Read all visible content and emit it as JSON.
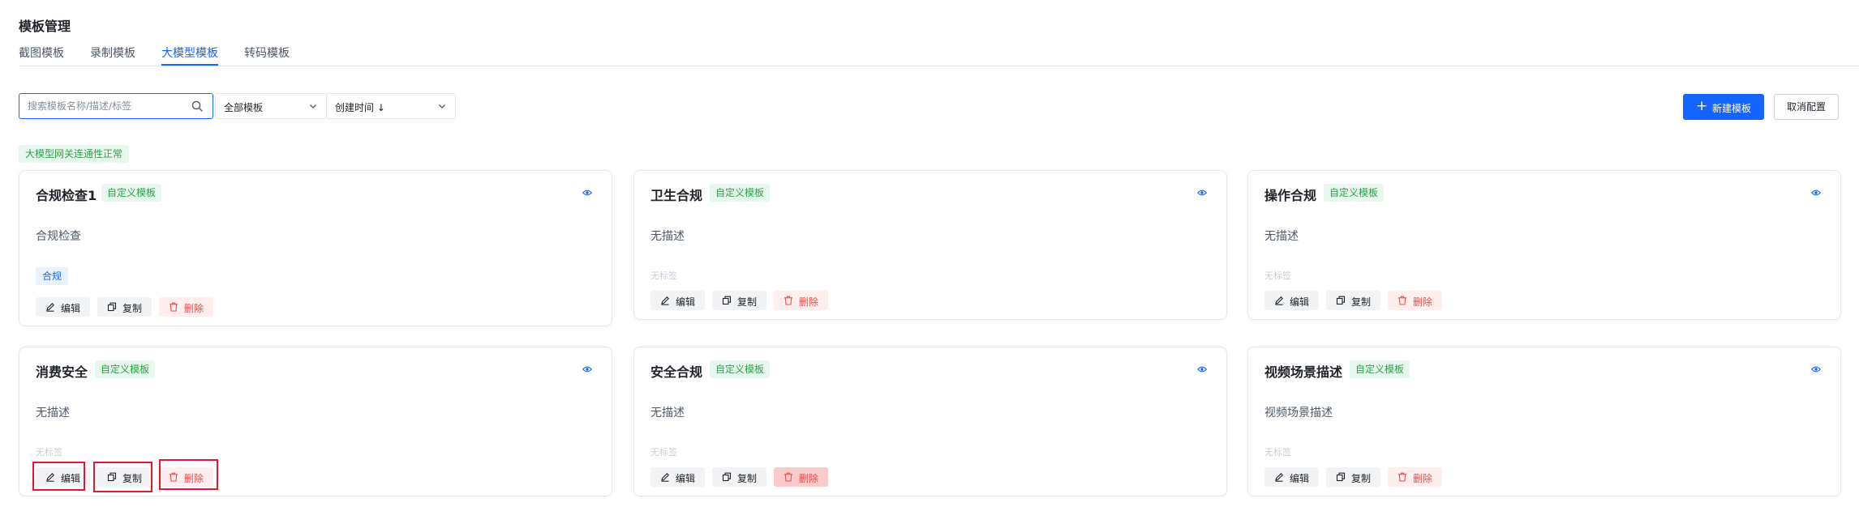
{
  "header": {
    "title": "模板管理"
  },
  "tabs": [
    {
      "label": "截图模板",
      "active": false
    },
    {
      "label": "录制模板",
      "active": false
    },
    {
      "label": "大模型模板",
      "active": true
    },
    {
      "label": "转码模板",
      "active": false
    }
  ],
  "toolbar": {
    "search_placeholder": "搜索模板名称/描述/标签",
    "filter_value": "全部模板",
    "sort_value": "创建时间 ↓",
    "new_button": "新建模板",
    "new_icon": "+",
    "cancel_button": "取消配置"
  },
  "status_badge": "大模型网关连通性正常",
  "card_actions": {
    "edit": "编辑",
    "copy": "复制",
    "delete": "删除"
  },
  "cards": [
    {
      "title": "合规检查1",
      "badge": "自定义模板",
      "desc": "合规检查",
      "tag": "合规"
    },
    {
      "title": "卫生合规",
      "badge": "自定义模板",
      "desc": "无描述",
      "no_tag": "无标签"
    },
    {
      "title": "操作合规",
      "badge": "自定义模板",
      "desc": "无描述",
      "no_tag": "无标签"
    },
    {
      "title": "消费安全",
      "badge": "自定义模板",
      "desc": "无描述",
      "no_tag": "无标签"
    },
    {
      "title": "安全合规",
      "badge": "自定义模板",
      "desc": "无描述",
      "no_tag": "无标签"
    },
    {
      "title": "视频场景描述",
      "badge": "自定义模板",
      "desc": "视频场景描述",
      "no_tag": "无标签"
    }
  ],
  "colors": {
    "primary": "#1664ff",
    "success_text": "#2ba343",
    "success_bg": "#e8f8ee",
    "danger_text": "#f54a45",
    "danger_bg": "#feeeee",
    "highlight_box": "#e8152e"
  }
}
